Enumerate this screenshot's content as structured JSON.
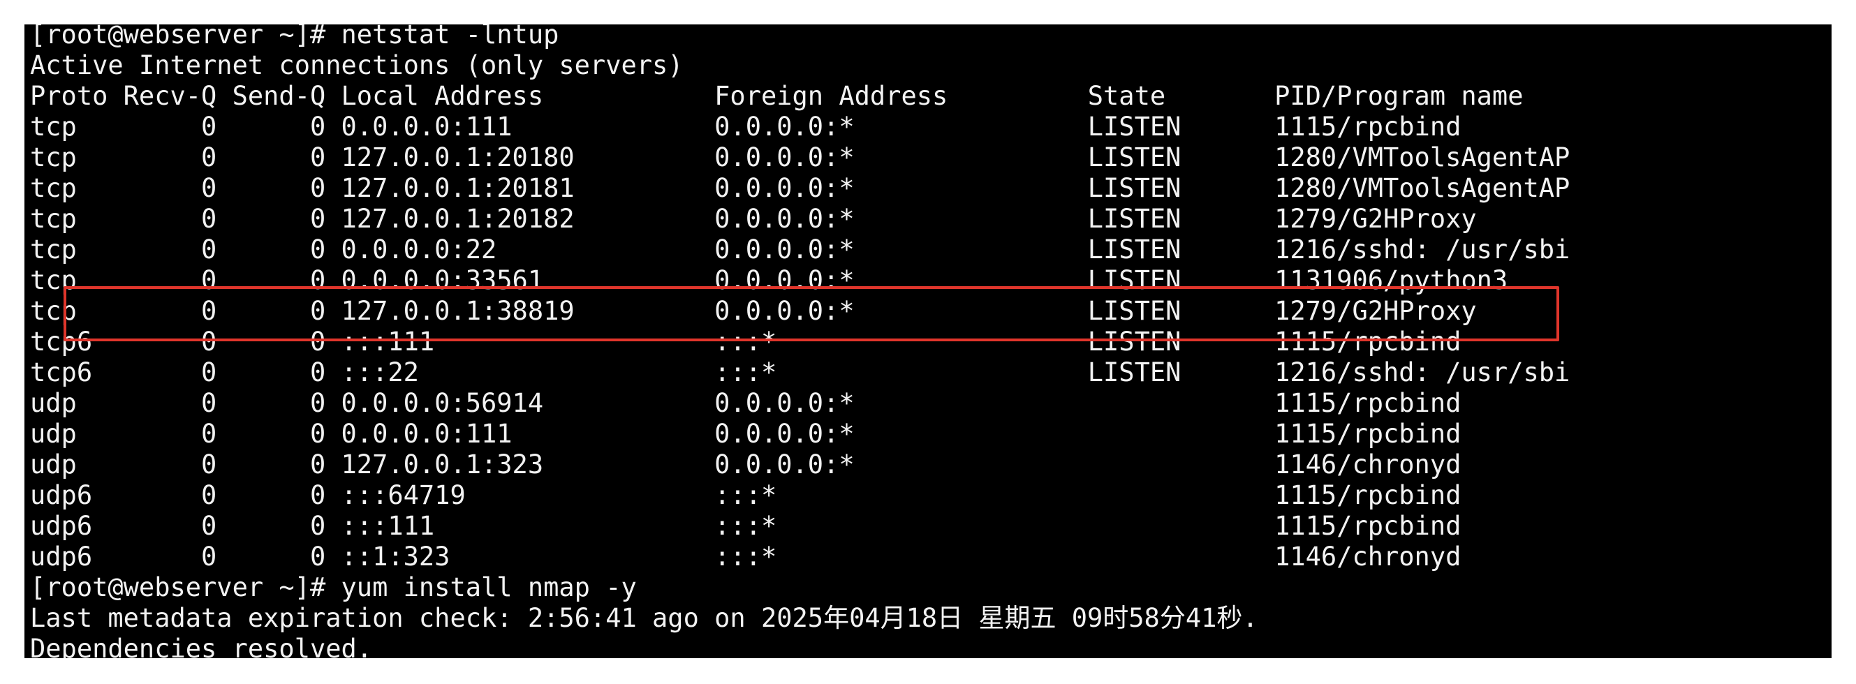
{
  "terminal": {
    "top_partial": "[root@webserver ~]# netstat -lntup",
    "lines": [
      "[root@webserver ~]# netstat -lntup",
      "Active Internet connections (only servers)",
      "Proto Recv-Q Send-Q Local Address           Foreign Address         State       PID/Program name",
      "tcp        0      0 0.0.0.0:111             0.0.0.0:*               LISTEN      1115/rpcbind",
      "tcp        0      0 127.0.0.1:20180         0.0.0.0:*               LISTEN      1280/VMToolsAgentAP",
      "tcp        0      0 127.0.0.1:20181         0.0.0.0:*               LISTEN      1280/VMToolsAgentAP",
      "tcp        0      0 127.0.0.1:20182         0.0.0.0:*               LISTEN      1279/G2HProxy",
      "tcp        0      0 0.0.0.0:22              0.0.0.0:*               LISTEN      1216/sshd: /usr/sbi",
      "tcp        0      0 0.0.0.0:33561           0.0.0.0:*               LISTEN      1131906/python3",
      "tcp        0      0 127.0.0.1:38819         0.0.0.0:*               LISTEN      1279/G2HProxy",
      "tcp6       0      0 :::111                  :::*                    LISTEN      1115/rpcbind",
      "tcp6       0      0 :::22                   :::*                    LISTEN      1216/sshd: /usr/sbi",
      "udp        0      0 0.0.0.0:56914           0.0.0.0:*                           1115/rpcbind",
      "udp        0      0 0.0.0.0:111             0.0.0.0:*                           1115/rpcbind",
      "udp        0      0 127.0.0.1:323           0.0.0.0:*                           1146/chronyd",
      "udp6       0      0 :::64719                :::*                                1115/rpcbind",
      "udp6       0      0 :::111                  :::*                                1115/rpcbind",
      "udp6       0      0 ::1:323                 :::*                                1146/chronyd",
      "[root@webserver ~]# yum install nmap -y",
      "Last metadata expiration check: 2:56:41 ago on 2025年04月18日 星期五 09时58分41秒.",
      "Dependencies resolved."
    ]
  },
  "colors": {
    "terminal_bg": "#000000",
    "terminal_fg": "#f2f2f2",
    "highlight_border": "#e0352b"
  }
}
